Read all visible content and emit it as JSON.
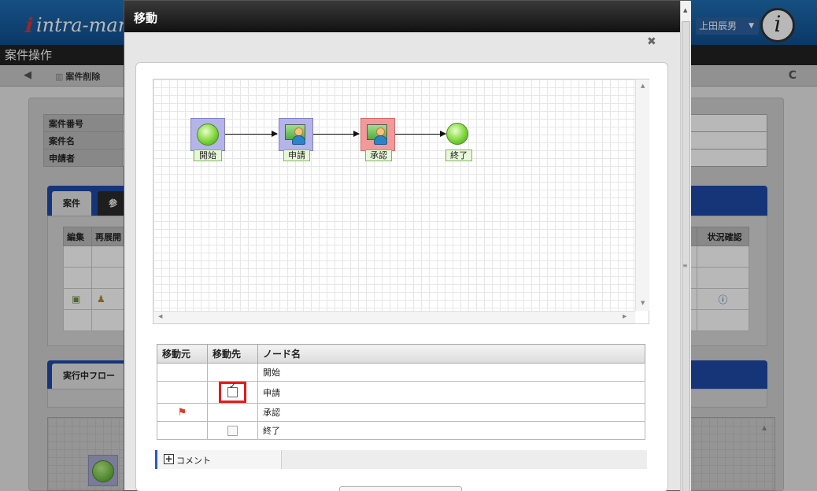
{
  "app": {
    "logo_text": "intra-mart",
    "user_name": "上田辰男",
    "page_title": "案件操作",
    "toolbar": {
      "delete_label": "案件削除"
    },
    "info_labels": [
      "案件番号",
      "案件名",
      "申請者"
    ],
    "tabs": [
      "案件",
      "参照"
    ],
    "grid_headers": [
      "編集",
      "再展開",
      "状況確認"
    ],
    "flow_tab": "実行中フロー"
  },
  "dialog": {
    "title": "移動",
    "flow": {
      "nodes": [
        {
          "label": "開始",
          "kind": "start"
        },
        {
          "label": "申請",
          "kind": "task"
        },
        {
          "label": "承認",
          "kind": "task-current"
        },
        {
          "label": "終了",
          "kind": "end"
        }
      ]
    },
    "table": {
      "headers": [
        "移動元",
        "移動先",
        "ノード名"
      ],
      "rows": [
        {
          "source_flag": false,
          "target_checkbox": "none",
          "node_name": "開始"
        },
        {
          "source_flag": false,
          "target_checkbox": "checked",
          "node_name": "申請"
        },
        {
          "source_flag": true,
          "target_checkbox": "none",
          "node_name": "承認"
        },
        {
          "source_flag": false,
          "target_checkbox": "unchecked",
          "node_name": "終了"
        }
      ]
    },
    "comment_label": "コメント"
  },
  "icons": {
    "close": "close-icon",
    "back": "back-arrow-icon",
    "refresh": "refresh-icon",
    "trash": "trash-icon",
    "flag": "flag-icon",
    "plus": "plus-icon",
    "info": "info-icon"
  },
  "colors": {
    "highlight": "#e11c1c",
    "current_node": "#f29a9a",
    "node": "#b4b4e8",
    "title_bar": "#111111",
    "header_blue": "#1f4aa8"
  }
}
